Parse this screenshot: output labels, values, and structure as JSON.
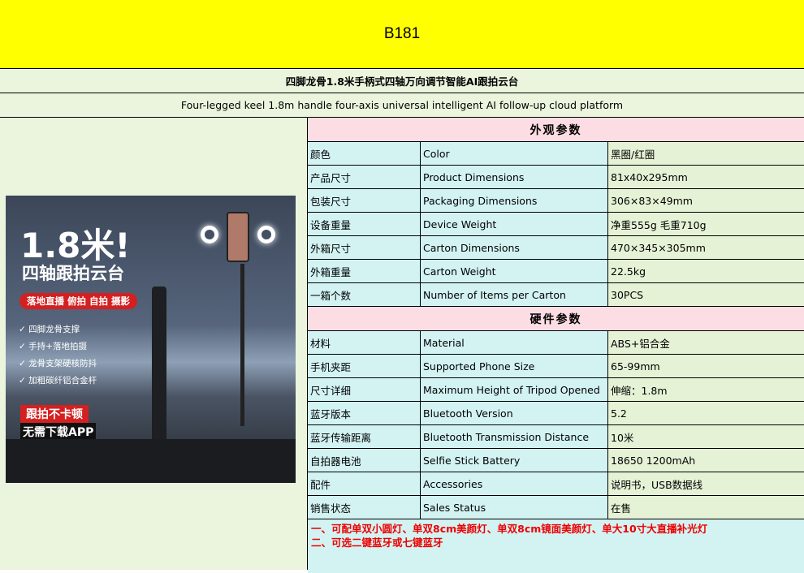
{
  "header": {
    "code": "B181"
  },
  "title_cn": "四脚龙骨1.8米手柄式四轴万向调节智能AI跟拍云台",
  "title_en": "Four-legged keel 1.8m handle four-axis universal intelligent AI follow-up cloud platform",
  "image": {
    "headline": "1.8米!",
    "subhead": "四轴跟拍云台",
    "tag": "落地直播 俯拍 自拍 摄影",
    "features": [
      "四脚龙骨支撑",
      "手持+落地拍摄",
      "龙骨支架硬核防抖",
      "加粗碳纤铝合金杆"
    ],
    "badge1": "跟拍不卡顿",
    "badge2": "无需下载APP"
  },
  "sections": [
    {
      "title": "外观参数",
      "rows": [
        [
          "颜色",
          "Color",
          "黑圈/红圈"
        ],
        [
          "产品尺寸",
          "Product Dimensions",
          "81x40x295mm"
        ],
        [
          "包装尺寸",
          "Packaging Dimensions",
          "306×83×49mm"
        ],
        [
          "设备重量",
          "Device Weight",
          "净重555g  毛重710g"
        ],
        [
          "外箱尺寸",
          "Carton Dimensions",
          "470×345×305mm"
        ],
        [
          "外箱重量",
          "Carton Weight",
          "22.5kg"
        ],
        [
          "一箱个数",
          "Number of Items per Carton",
          "30PCS"
        ]
      ]
    },
    {
      "title": "硬件参数",
      "rows": [
        [
          "材料",
          "Material",
          "ABS+铝合金"
        ],
        [
          "手机夹距",
          "Supported Phone Size",
          "65-99mm"
        ],
        [
          "尺寸详细",
          "Maximum Height of Tripod Opened",
          "伸缩：1.8m"
        ],
        [
          "蓝牙版本",
          "Bluetooth Version",
          "5.2"
        ],
        [
          "蓝牙传输距离",
          "Bluetooth Transmission Distance",
          "10米"
        ],
        [
          "自拍器电池",
          "Selfie Stick Battery",
          "18650    1200mAh"
        ],
        [
          "配件",
          "Accessories",
          "说明书，USB数据线"
        ],
        [
          "销售状态",
          "Sales Status",
          "在售"
        ]
      ]
    }
  ],
  "notes": [
    "一、可配单双小圆灯、单双8cm美颜灯、单双8cm镜面美颜灯、单大10寸大直播补光灯",
    "二、可选二键蓝牙或七键蓝牙"
  ]
}
